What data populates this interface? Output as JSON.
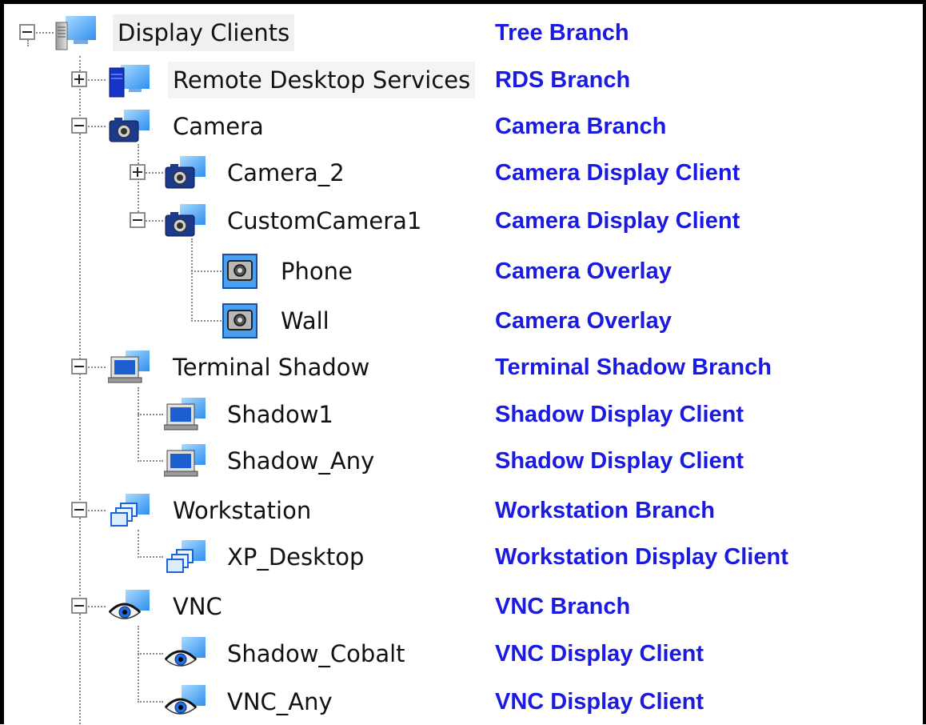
{
  "tree": {
    "root": {
      "label": "Display Clients",
      "description": "Tree Branch",
      "icon": "server-monitor-icon",
      "expanded": true
    },
    "rds": {
      "label": "Remote Desktop Services",
      "description": "RDS Branch",
      "icon": "server-monitor-icon",
      "expanded": false
    },
    "camera": {
      "label": "Camera",
      "description": "Camera Branch",
      "icon": "camera-icon",
      "expanded": true,
      "children": [
        {
          "label": "Camera_2",
          "description": "Camera Display Client",
          "icon": "camera-icon",
          "expanded": false
        },
        {
          "label": "CustomCamera1",
          "description": "Camera Display Client",
          "icon": "camera-icon",
          "expanded": true,
          "children": [
            {
              "label": "Phone",
              "description": "Camera Overlay",
              "icon": "camera-overlay-icon"
            },
            {
              "label": "Wall",
              "description": "Camera Overlay",
              "icon": "camera-overlay-icon"
            }
          ]
        }
      ]
    },
    "terminal_shadow": {
      "label": "Terminal Shadow",
      "description": "Terminal Shadow Branch",
      "icon": "laptop-icon",
      "expanded": true,
      "children": [
        {
          "label": "Shadow1",
          "description": "Shadow Display Client",
          "icon": "laptop-icon"
        },
        {
          "label": "Shadow_Any",
          "description": "Shadow Display Client",
          "icon": "laptop-icon"
        }
      ]
    },
    "workstation": {
      "label": "Workstation",
      "description": "Workstation Branch",
      "icon": "windows-icon",
      "expanded": true,
      "children": [
        {
          "label": "XP_Desktop",
          "description": "Workstation Display Client",
          "icon": "windows-icon"
        }
      ]
    },
    "vnc": {
      "label": "VNC",
      "description": "VNC Branch",
      "icon": "eye-icon",
      "expanded": true,
      "children": [
        {
          "label": "Shadow_Cobalt",
          "description": "VNC Display Client",
          "icon": "eye-icon"
        },
        {
          "label": "VNC_Any",
          "description": "VNC Display Client",
          "icon": "eye-icon"
        }
      ]
    }
  },
  "colors": {
    "description_text": "#1a1ae0",
    "connector": "#8a8a8a",
    "frame": "#000000"
  }
}
